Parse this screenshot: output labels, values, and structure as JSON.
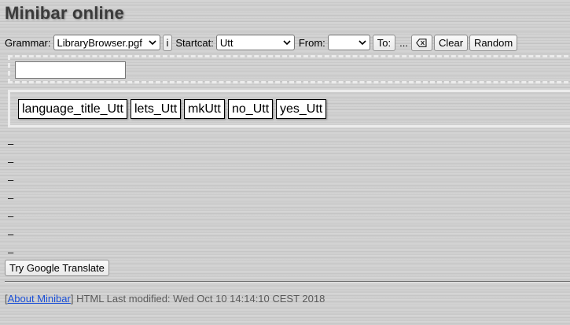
{
  "header": {
    "title": "Minibar online"
  },
  "toolbar": {
    "grammar_label": "Grammar:",
    "grammar_value": "LibraryBrowser.pgf",
    "info_label": "i",
    "startcat_label": "Startcat:",
    "startcat_value": "Utt",
    "from_label": "From:",
    "from_value": "",
    "to_label": "To:",
    "ellipsis": "...",
    "backspace_label": "⌫",
    "clear_label": "Clear",
    "random_label": "Random"
  },
  "input": {
    "value": ""
  },
  "words": [
    "language_title_Utt",
    "lets_Utt",
    "mkUtt",
    "no_Utt",
    "yes_Utt"
  ],
  "dash_lines": [
    "–",
    "–",
    "–",
    "–",
    "–",
    "–",
    "–"
  ],
  "google_button": {
    "label": "Try Google Translate"
  },
  "footer": {
    "open_bracket": "[",
    "about_link": "About Minibar",
    "close_bracket": "]",
    "modified_text": " HTML Last modified: Wed Oct 10 14:14:10 CEST 2018"
  },
  "icons": {
    "grammar_chevron": "chevron-down-icon",
    "startcat_chevron": "chevron-down-icon",
    "from_chevron": "chevron-down-icon",
    "backspace": "backspace-icon"
  }
}
